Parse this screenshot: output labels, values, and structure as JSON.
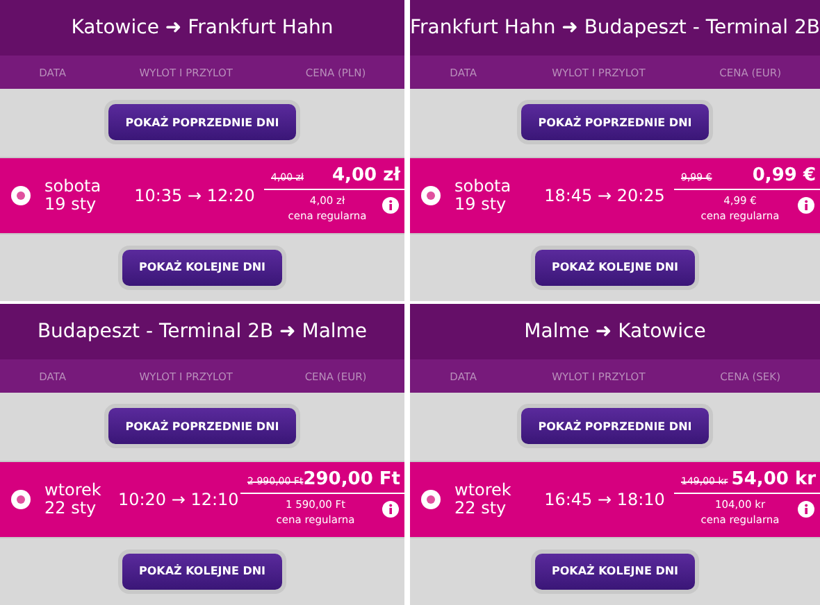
{
  "panels": [
    {
      "title": "Katowice ➜ Frankfurt Hahn",
      "columns": [
        "DATA",
        "WYLOT I PRZYLOT",
        "CENA (PLN)"
      ],
      "prev_button": "POKAŻ POPRZEDNIE DNI",
      "flight": {
        "day": "sobota",
        "date": "19 sty",
        "times": "10:35 → 12:20",
        "old_price": "4,00 zł",
        "price": "4,00 zł",
        "regular_price": "4,00 zł",
        "regular_label": "cena regularna"
      },
      "next_button": "POKAŻ KOLEJNE DNI"
    },
    {
      "title": "Frankfurt Hahn ➜ Budapeszt - Terminal 2B",
      "columns": [
        "DATA",
        "WYLOT I PRZYLOT",
        "CENA (EUR)"
      ],
      "prev_button": "POKAŻ POPRZEDNIE DNI",
      "flight": {
        "day": "sobota",
        "date": "19 sty",
        "times": "18:45 → 20:25",
        "old_price": "9,99 €",
        "price": "0,99 €",
        "regular_price": "4,99 €",
        "regular_label": "cena regularna"
      },
      "next_button": "POKAŻ KOLEJNE DNI"
    },
    {
      "title": "Budapeszt - Terminal 2B ➜ Malme",
      "columns": [
        "DATA",
        "WYLOT I PRZYLOT",
        "CENA (EUR)"
      ],
      "prev_button": "POKAŻ POPRZEDNIE DNI",
      "flight": {
        "day": "wtorek",
        "date": "22 sty",
        "times": "10:20 → 12:10",
        "old_price": "2 990,00 Ft",
        "price": "290,00 Ft",
        "regular_price": "1 590,00 Ft",
        "regular_label": "cena regularna"
      },
      "next_button": "POKAŻ KOLEJNE DNI"
    },
    {
      "title": "Malme ➜ Katowice",
      "columns": [
        "DATA",
        "WYLOT I PRZYLOT",
        "CENA (SEK)"
      ],
      "prev_button": "POKAŻ POPRZEDNIE DNI",
      "flight": {
        "day": "wtorek",
        "date": "22 sty",
        "times": "16:45 → 18:10",
        "old_price": "149,00 kr",
        "price": "54,00 kr",
        "regular_price": "104,00 kr",
        "regular_label": "cena regularna"
      },
      "next_button": "POKAŻ KOLEJNE DNI"
    }
  ]
}
